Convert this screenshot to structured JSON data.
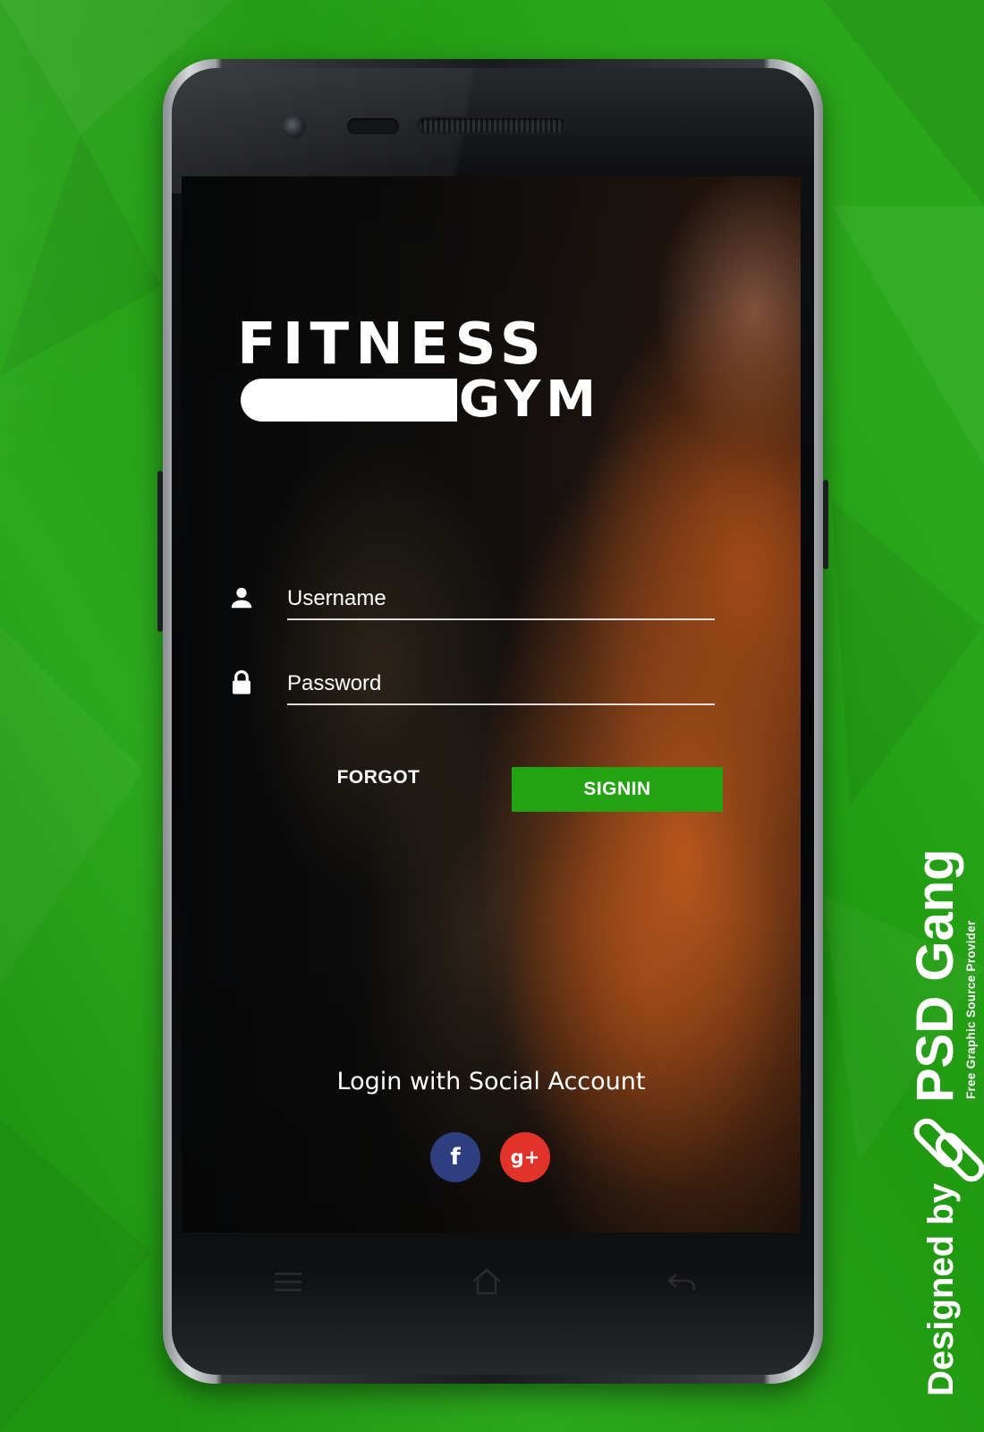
{
  "app": {
    "logo_top": "FITNESS",
    "logo_bottom": "GYM"
  },
  "login": {
    "username_placeholder": "Username",
    "password_placeholder": "Password",
    "forgot_label": "FORGOT",
    "signin_label": "SIGNIN"
  },
  "social": {
    "label": "Login with Social Account",
    "facebook_glyph": "f",
    "google_glyph": "g+"
  },
  "icons": {
    "username": "user-icon",
    "password": "lock-icon",
    "nav_menu": "menu-icon",
    "nav_home": "home-icon",
    "nav_back": "back-icon"
  },
  "watermark": {
    "designed_by": "Designed by",
    "brand": "PSD Gang",
    "tagline": "Free Graphic Source Provider"
  },
  "colors": {
    "background": "#22a312",
    "signin_button": "#22a312",
    "facebook": "#2d3f7f",
    "google": "#e2332a"
  }
}
